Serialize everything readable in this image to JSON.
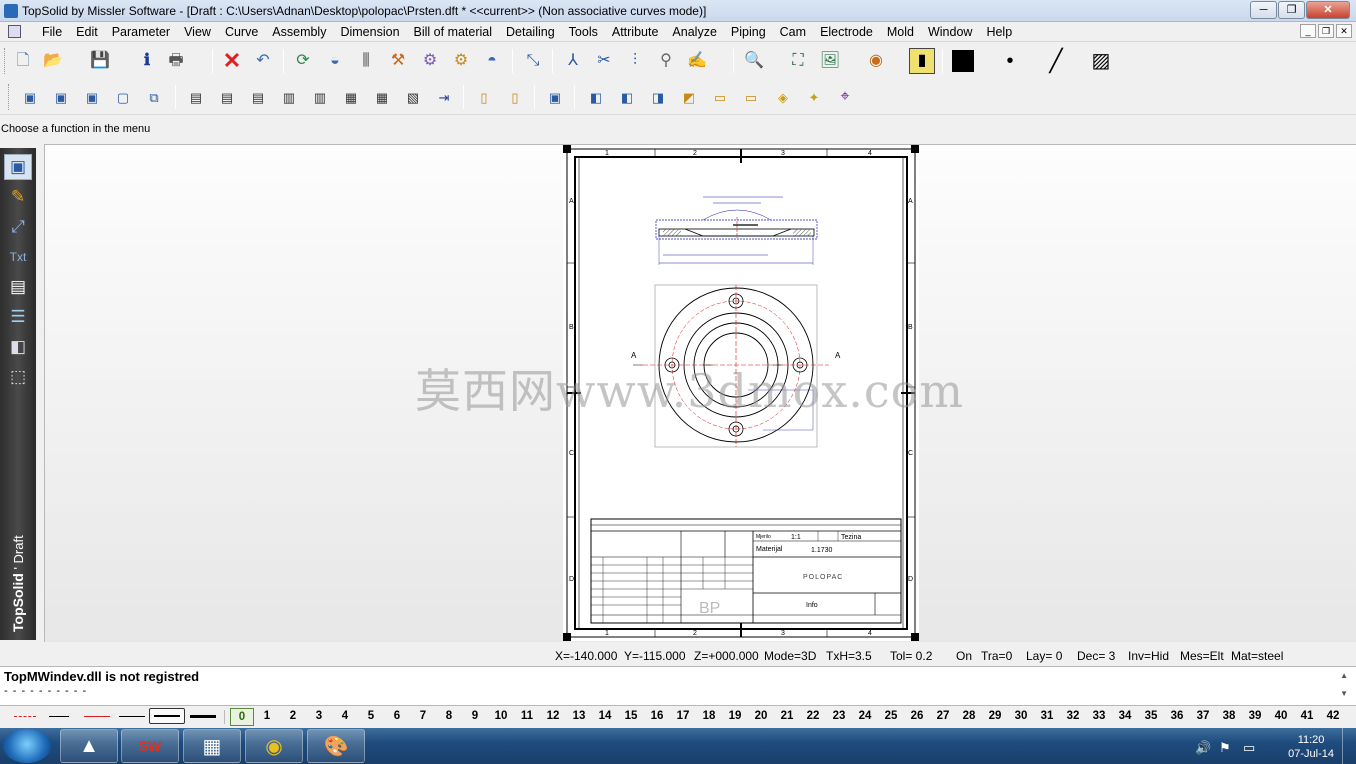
{
  "window": {
    "title": "TopSolid by Missler Software - [Draft : C:\\Users\\Adnan\\Desktop\\polopac\\Prsten.dft *  <<current>> (Non associative curves mode)]",
    "minimize": "─",
    "restore": "❐",
    "close": "✕"
  },
  "menu": [
    "File",
    "Edit",
    "Parameter",
    "View",
    "Curve",
    "Assembly",
    "Dimension",
    "Bill of material",
    "Detailing",
    "Tools",
    "Attribute",
    "Analyze",
    "Piping",
    "Cam",
    "Electrode",
    "Mold",
    "Window",
    "Help"
  ],
  "mdi_buttons": [
    "_",
    "❐",
    "✕"
  ],
  "toolbar1_icons": [
    "new-document-icon",
    "open-folder-icon",
    "save-icon",
    "info-icon",
    "print-icon",
    "delete-icon",
    "undo-icon",
    "refresh-icon",
    "curve-tool-icon",
    "settings-icon",
    "hammer-icon",
    "gear-icon",
    "pointer-icon",
    "circle-arc-icon",
    "tree-icon",
    "fork-icon",
    "adjust-icon",
    "hook-icon",
    "handwrite-icon",
    "zoom-icon",
    "zoom-fit-icon",
    "image-icon",
    "eye-icon",
    "pencil-cylinder-icon",
    "color-swatch-icon",
    "dot-style-icon",
    "line-style-icon",
    "hatch-icon"
  ],
  "toolbar2_icons": [
    "view-frame-icon",
    "view-frame2-icon",
    "view-frame3-icon",
    "view-frame4-icon",
    "view-frame5-icon",
    "view-frame6-icon",
    "view-frame7-icon",
    "view-frame8-icon",
    "view-frame9-icon",
    "view-frame10-icon",
    "view-frame11-icon",
    "view-frame12-icon",
    "view-frame13-icon",
    "view-frame14-icon",
    "view-frame15-icon",
    "book-icon",
    "book2-icon",
    "sheet-icon",
    "box-icon",
    "box2-icon",
    "box3-icon",
    "box4-icon",
    "box5-icon",
    "box6-icon",
    "box7-icon",
    "crosshair-icon"
  ],
  "status_prompt": "Choose a function in the menu",
  "left_tabs": [
    "select-icon",
    "pencil-icon",
    "measure-icon",
    "text-tool-icon",
    "table-icon",
    "layers-icon",
    "box-view-icon",
    "solid-icon"
  ],
  "left_brand": "TopSolid",
  "left_brand_sub": " ' Draft",
  "watermark": "莫西网www.3dmox.com",
  "drawing": {
    "col_labels": [
      "1",
      "2",
      "3",
      "4"
    ],
    "row_labels": [
      "A",
      "B",
      "C",
      "D"
    ],
    "section_label": "A",
    "title_block": {
      "scale_label": "Mjerilo",
      "scale": "1:1",
      "weight_label": "Tezina",
      "material_label": "Materijal",
      "material": "1.1730",
      "part_name": "POLOPAC",
      "info": "Info",
      "logo": "BP"
    },
    "colors": {
      "line": "#000000",
      "dim": "#1a1ab4",
      "center": "#e01010",
      "hatch": "#222222"
    }
  },
  "coords": {
    "x": "X=-140.000",
    "y": "Y=-115.000",
    "z": "Z=+000.000",
    "mode": "Mode=3D",
    "txh": "TxH=3.5",
    "tol": "Tol=  0.2",
    "on": "On",
    "tra": "Tra=0",
    "lay": "Lay=  0",
    "dec": "Dec= 3",
    "inv": "Inv=Hid",
    "mes": "Mes=Elt",
    "mat": "Mat=steel"
  },
  "message": "TopMWindev.dll is not registred",
  "message_dashes": "- - - - - - - - - -",
  "layers": [
    "0",
    "1",
    "2",
    "3",
    "4",
    "5",
    "6",
    "7",
    "8",
    "9",
    "10",
    "11",
    "12",
    "13",
    "14",
    "15",
    "16",
    "17",
    "18",
    "19",
    "20",
    "21",
    "22",
    "23",
    "24",
    "25",
    "26",
    "27",
    "28",
    "29",
    "30",
    "31",
    "32",
    "33",
    "34",
    "35",
    "36",
    "37",
    "38",
    "39",
    "40",
    "41",
    "42"
  ],
  "taskbar": {
    "apps": [
      "topsolid-app-icon",
      "solidworks-app-icon",
      "calculator-app-icon",
      "chrome-app-icon",
      "paint-app-icon"
    ],
    "app_glyphs": [
      "▲",
      "SW",
      "▦",
      "◉",
      "🎨"
    ],
    "time": "11:20",
    "date": "07-Jul-14"
  }
}
